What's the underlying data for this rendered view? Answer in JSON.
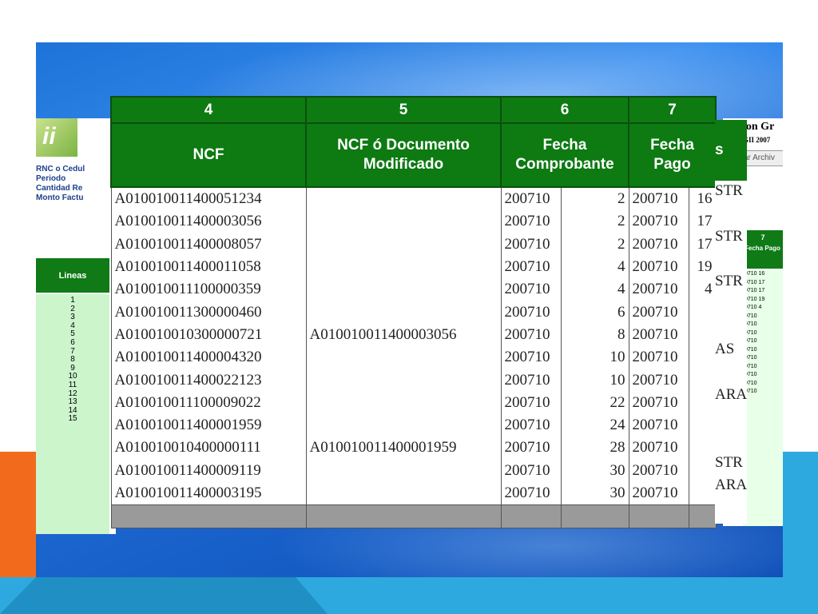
{
  "background_window": {
    "logo_text": "ii",
    "info_labels": [
      "RNC o Cedul",
      "Periodo",
      "Cantidad Re",
      "Monto Factu"
    ],
    "lineas_header": "Lineas",
    "line_numbers": [
      "1",
      "2",
      "3",
      "4",
      "5",
      "6",
      "7",
      "8",
      "9",
      "10",
      "11",
      "12",
      "13",
      "14",
      "15"
    ]
  },
  "right_window": {
    "title": "ion Gr",
    "subtitle": "GII 2007",
    "button_label": "ar Archiv",
    "mini_col_num": "7",
    "mini_col_header": "Fecha Pago",
    "mini_col_values": [
      "0710 16",
      "0710 17",
      "0710 17",
      "0710 19",
      "0710 4",
      "0710",
      "0710",
      "0710",
      "0710",
      "0710",
      "0710",
      "0710",
      "0710",
      "0710",
      "0710"
    ]
  },
  "table": {
    "column_numbers": [
      "4",
      "5",
      "6",
      "7"
    ],
    "headers": {
      "ncf": "NCF",
      "ncf_mod_line1": "NCF ó  Documento",
      "ncf_mod_line2": "Modificado",
      "fecha_comp_line1": "Fecha",
      "fecha_comp_line2": "Comprobante",
      "fecha_pago_line1": "Fecha",
      "fecha_pago_line2": "Pago",
      "side_header": "s"
    },
    "rows": [
      {
        "ncf": "A010010011400051234",
        "mod": "",
        "fc_period": "200710",
        "fc_day": "2",
        "fp_period": "200710",
        "fp_day": "16",
        "side": "STR"
      },
      {
        "ncf": "A010010011400003056",
        "mod": "",
        "fc_period": "200710",
        "fc_day": "2",
        "fp_period": "200710",
        "fp_day": "17",
        "side": ""
      },
      {
        "ncf": "A010010011400008057",
        "mod": "",
        "fc_period": "200710",
        "fc_day": "2",
        "fp_period": "200710",
        "fp_day": "17",
        "side": "STR"
      },
      {
        "ncf": "A010010011400011058",
        "mod": "",
        "fc_period": "200710",
        "fc_day": "4",
        "fp_period": "200710",
        "fp_day": "19",
        "side": ""
      },
      {
        "ncf": "A010010011100000359",
        "mod": "",
        "fc_period": "200710",
        "fc_day": "4",
        "fp_period": "200710",
        "fp_day": "4",
        "side": "STR"
      },
      {
        "ncf": "A010010011300000460",
        "mod": "",
        "fc_period": "200710",
        "fc_day": "6",
        "fp_period": "200710",
        "fp_day": "",
        "side": ""
      },
      {
        "ncf": "A010010010300000721",
        "mod": "A010010011400003056",
        "fc_period": "200710",
        "fc_day": "8",
        "fp_period": "200710",
        "fp_day": "",
        "side": ""
      },
      {
        "ncf": "A010010011400004320",
        "mod": "",
        "fc_period": "200710",
        "fc_day": "10",
        "fp_period": "200710",
        "fp_day": "",
        "side": "AS"
      },
      {
        "ncf": "A010010011400022123",
        "mod": "",
        "fc_period": "200710",
        "fc_day": "10",
        "fp_period": "200710",
        "fp_day": "",
        "side": ""
      },
      {
        "ncf": "A010010011100009022",
        "mod": "",
        "fc_period": "200710",
        "fc_day": "22",
        "fp_period": "200710",
        "fp_day": "",
        "side": "ARA"
      },
      {
        "ncf": "A010010011400001959",
        "mod": "",
        "fc_period": "200710",
        "fc_day": "24",
        "fp_period": "200710",
        "fp_day": "",
        "side": ""
      },
      {
        "ncf": "A010010010400000111",
        "mod": "A010010011400001959",
        "fc_period": "200710",
        "fc_day": "28",
        "fp_period": "200710",
        "fp_day": "",
        "side": ""
      },
      {
        "ncf": "A010010011400009119",
        "mod": "",
        "fc_period": "200710",
        "fc_day": "30",
        "fp_period": "200710",
        "fp_day": "",
        "side": "STR"
      },
      {
        "ncf": "A010010011400003195",
        "mod": "",
        "fc_period": "200710",
        "fc_day": "30",
        "fp_period": "200710",
        "fp_day": "",
        "side": "ARA"
      }
    ]
  }
}
